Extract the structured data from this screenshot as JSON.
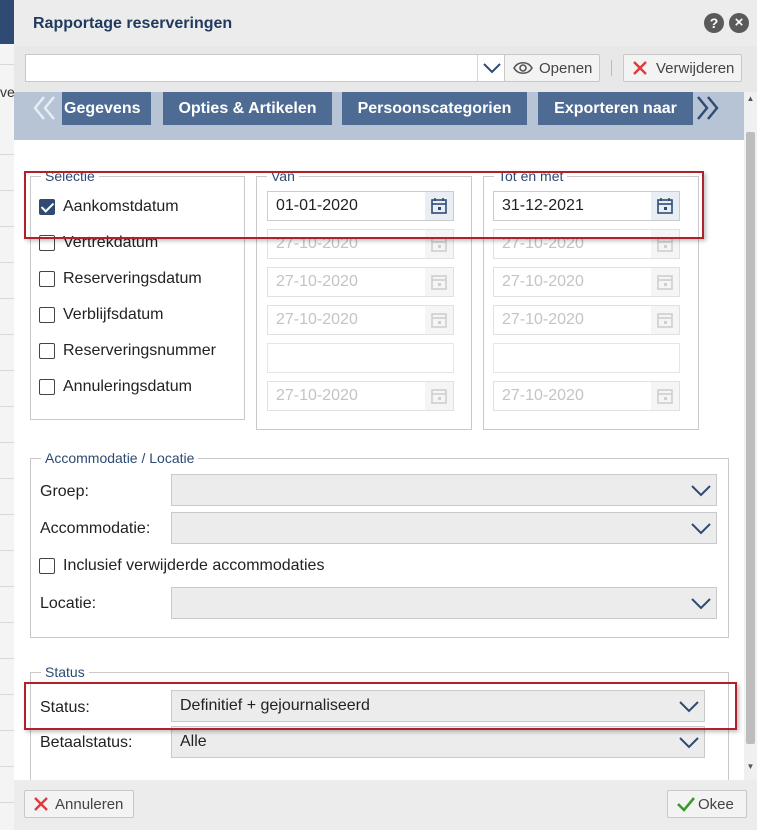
{
  "background": {
    "partial_text": "ve"
  },
  "dialog": {
    "title": "Rapportage reserveringen",
    "help_icon": "?",
    "close_icon": "×"
  },
  "toolbar": {
    "report_select_value": "",
    "open_label": "Openen",
    "delete_label": "Verwijderen"
  },
  "tabs": [
    {
      "label": "Gegevens"
    },
    {
      "label": "Opties & Artikelen"
    },
    {
      "label": "Persoonscategorien"
    },
    {
      "label": "Exporteren naar"
    }
  ],
  "selectie": {
    "legend": "Selectie",
    "items": [
      {
        "label": "Aankomstdatum",
        "checked": true
      },
      {
        "label": "Vertrekdatum",
        "checked": false
      },
      {
        "label": "Reserveringsdatum",
        "checked": false
      },
      {
        "label": "Verblijfsdatum",
        "checked": false
      },
      {
        "label": "Reserveringsnummer",
        "checked": false
      },
      {
        "label": "Annuleringsdatum",
        "checked": false
      }
    ]
  },
  "van": {
    "legend": "Van",
    "dates": [
      "01-01-2020",
      "27-10-2020",
      "27-10-2020",
      "27-10-2020",
      "",
      "27-10-2020"
    ]
  },
  "tot": {
    "legend": "Tot en met",
    "dates": [
      "31-12-2021",
      "27-10-2020",
      "27-10-2020",
      "27-10-2020",
      "",
      "27-10-2020"
    ]
  },
  "accommodatie": {
    "legend": "Accommodatie / Locatie",
    "groep_label": "Groep:",
    "groep_value": "",
    "accommodatie_label": "Accommodatie:",
    "accommodatie_value": "",
    "inclusief_label": "Inclusief verwijderde accommodaties",
    "inclusief_checked": false,
    "locatie_label": "Locatie:",
    "locatie_value": ""
  },
  "status": {
    "legend": "Status",
    "status_label": "Status:",
    "status_value": "Definitief + gejournaliseerd",
    "betaal_label": "Betaalstatus:",
    "betaal_value": "Alle"
  },
  "footer": {
    "cancel_label": "Annuleren",
    "ok_label": "Okee"
  },
  "colors": {
    "accent": "#2f4b73",
    "tab": "#4e6b94",
    "highlight": "#b0222a",
    "danger": "#e03a3a",
    "success": "#3a9a2a"
  }
}
